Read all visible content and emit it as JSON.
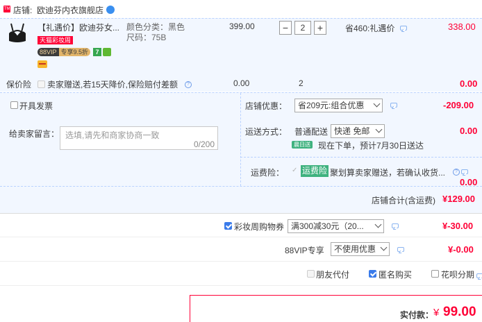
{
  "shop": {
    "label": "店铺:",
    "name": "欧迪芬内衣旗舰店",
    "tmall_badge": "TM"
  },
  "item": {
    "title": "【礼遇价】欧迪芬女...",
    "tags": {
      "tmall_promo": "天猫彩妆周",
      "vip": "88VIP",
      "vip_discount": "专享9.5折",
      "seven_days": "7"
    },
    "sku_color": "颜色分类：黑色",
    "sku_size": "尺码：75B",
    "unit_price": "399.00",
    "quantity": "2",
    "qty_minus": "−",
    "qty_plus": "+",
    "saving": "省460:礼遇价",
    "subtotal": "338.00"
  },
  "insurance": {
    "label": "保价险",
    "desc": "卖家赠送,若15天降价,保险赔付差额",
    "price": "0.00",
    "qty": "2",
    "total": "0.00"
  },
  "invoice": {
    "label": "开具发票"
  },
  "message": {
    "label": "给卖家留言：",
    "placeholder": "选填,请先和商家协商一致",
    "counter": "0/200"
  },
  "shop_discount": {
    "label": "店铺优惠：",
    "selected": "省209元:组合优惠",
    "amount": "-209.00"
  },
  "shipping": {
    "label": "运送方式：",
    "method": "普通配送",
    "selected": "快递 免邮",
    "amount": "0.00",
    "badge": "晨日送",
    "eta": "现在下单，预计7月30日送达"
  },
  "freight_insurance": {
    "label": "运费险：",
    "tag": "运费险",
    "desc": "聚划算卖家赠送，若确认收货...",
    "amount": "0.00"
  },
  "shop_total": {
    "label": "店铺合计(含运费)",
    "amount": "¥129.00"
  },
  "coupon": {
    "label": "彩妆周购物券",
    "selected": "满300减30元（20...",
    "amount": "¥-30.00",
    "checked": true
  },
  "vip": {
    "label": "88VIP专享",
    "selected": "不使用优惠",
    "amount": "¥-0.00"
  },
  "payment_options": [
    {
      "label": "朋友代付",
      "checked": false
    },
    {
      "label": "匿名购买",
      "checked": true
    },
    {
      "label": "花呗分期",
      "checked": false
    }
  ],
  "actual_pay": {
    "label": "实付款：",
    "currency": "¥",
    "amount": "99.00"
  },
  "colors": {
    "accent_red": "#ff0036",
    "panel_blue": "#f2f7ff",
    "link_blue": "#3a7bea"
  }
}
